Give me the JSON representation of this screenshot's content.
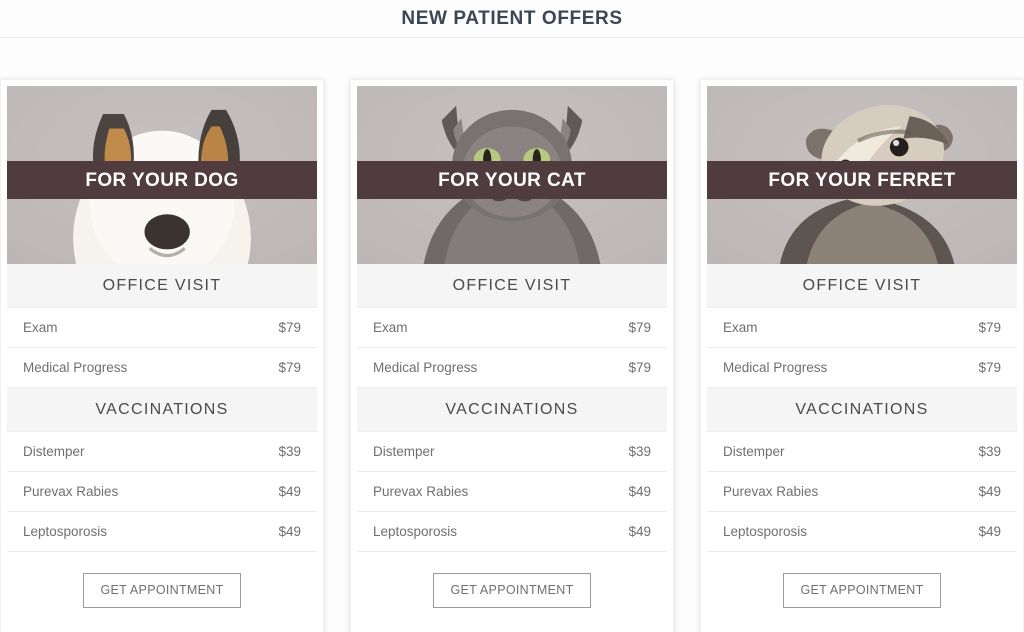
{
  "page": {
    "title": "NEW PATIENT OFFERS"
  },
  "theme": {
    "banner_color": "#503b3f",
    "hero_background": "#bcb6b6",
    "section_header_background": "#f5f5f5",
    "title_color": "#3b4653",
    "row_text_color": "#6f6f6f",
    "button_border_color": "#9a9a9a",
    "page_background": "#fdfdfd"
  },
  "cards": [
    {
      "animal": "dog",
      "banner_label": "FOR YOUR DOG",
      "image_alt": "puppy-photo",
      "sections": [
        {
          "header": "OFFICE VISIT",
          "rows": [
            {
              "name": "Exam",
              "price": "$79"
            },
            {
              "name": "Medical Progress",
              "price": "$79"
            }
          ]
        },
        {
          "header": "VACCINATIONS",
          "rows": [
            {
              "name": "Distemper",
              "price": "$39"
            },
            {
              "name": "Purevax Rabies",
              "price": "$49"
            },
            {
              "name": "Leptosporosis",
              "price": "$49"
            }
          ]
        }
      ],
      "cta_label": "GET APPOINTMENT"
    },
    {
      "animal": "cat",
      "banner_label": "FOR YOUR CAT",
      "image_alt": "cat-photo",
      "sections": [
        {
          "header": "OFFICE VISIT",
          "rows": [
            {
              "name": "Exam",
              "price": "$79"
            },
            {
              "name": "Medical Progress",
              "price": "$79"
            }
          ]
        },
        {
          "header": "VACCINATIONS",
          "rows": [
            {
              "name": "Distemper",
              "price": "$39"
            },
            {
              "name": "Purevax Rabies",
              "price": "$49"
            },
            {
              "name": "Leptosporosis",
              "price": "$49"
            }
          ]
        }
      ],
      "cta_label": "GET APPOINTMENT"
    },
    {
      "animal": "ferret",
      "banner_label": "FOR YOUR FERRET",
      "image_alt": "ferret-photo",
      "sections": [
        {
          "header": "OFFICE VISIT",
          "rows": [
            {
              "name": "Exam",
              "price": "$79"
            },
            {
              "name": "Medical Progress",
              "price": "$79"
            }
          ]
        },
        {
          "header": "VACCINATIONS",
          "rows": [
            {
              "name": "Distemper",
              "price": "$39"
            },
            {
              "name": "Purevax Rabies",
              "price": "$49"
            },
            {
              "name": "Leptosporosis",
              "price": "$49"
            }
          ]
        }
      ],
      "cta_label": "GET APPOINTMENT"
    }
  ]
}
